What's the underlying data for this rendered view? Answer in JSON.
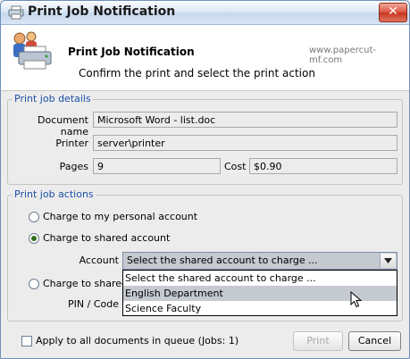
{
  "window": {
    "title": "Print Job Notification",
    "close_glyph": "✕"
  },
  "header": {
    "title": "Print Job Notification",
    "url": "www.papercut-mf.com",
    "subtitle": "Confirm the print and select the print action"
  },
  "details": {
    "legend": "Print job details",
    "document_label": "Document name",
    "document_value": "Microsoft Word - list.doc",
    "printer_label": "Printer",
    "printer_value": "server\\printer",
    "pages_label": "Pages",
    "pages_value": "9",
    "cost_label": "Cost",
    "cost_value": "$0.90"
  },
  "actions": {
    "legend": "Print job actions",
    "opt_personal": "Charge to my personal account",
    "opt_shared": "Charge to shared account",
    "opt_shared_pin": "Charge to shared a",
    "account_label": "Account",
    "account_selected": "Select the shared account to charge ...",
    "pin_label": "PIN / Code",
    "dropdown_options": [
      "Select the shared account to charge ...",
      "English Department",
      "Science Faculty"
    ],
    "selected_option": "Charge to shared account",
    "highlighted_option": "English Department"
  },
  "footer": {
    "apply_all_label": "Apply to all documents in queue (Jobs: 1)",
    "print_label": "Print",
    "cancel_label": "Cancel"
  },
  "icons": {
    "title": "printer-icon",
    "header": "printer-with-people-icon",
    "close": "close-icon",
    "dropdown": "chevron-down-icon",
    "cursor": "mouse-pointer-icon"
  },
  "colors": {
    "legend_text": "#1b4fa8",
    "close_button": "#d9533d",
    "title_bar": "#dbe7f6",
    "highlight": "#c5c9d0"
  }
}
